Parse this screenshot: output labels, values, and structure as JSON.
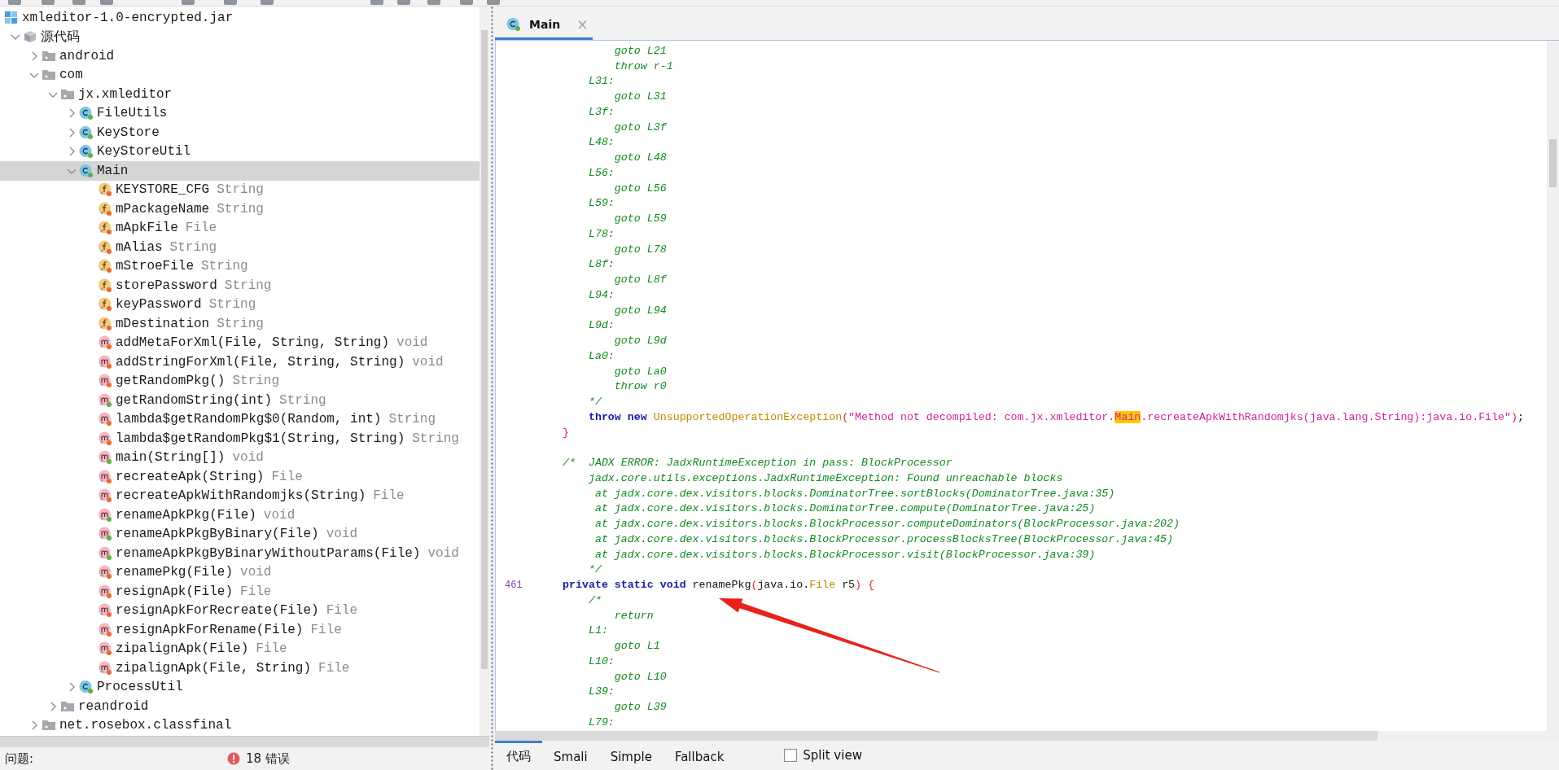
{
  "tree": [
    {
      "kind": "jar",
      "label": "xmleditor-1.0-encrypted.jar",
      "selected": false,
      "children": [
        {
          "kind": "source-root",
          "label": "源代码",
          "expanded": true,
          "selected": false,
          "children": [
            {
              "kind": "folder",
              "label": "android",
              "expanded": false,
              "selected": false
            },
            {
              "kind": "folder",
              "label": "com",
              "expanded": true,
              "selected": false,
              "children": [
                {
                  "kind": "folder",
                  "label": "jx.xmleditor",
                  "expanded": true,
                  "selected": false,
                  "children": [
                    {
                      "kind": "class",
                      "label": "FileUtils",
                      "color": "#5cb145",
                      "expanded": false,
                      "selected": false
                    },
                    {
                      "kind": "class",
                      "label": "KeyStore",
                      "color": "#5cb145",
                      "expanded": false,
                      "selected": false
                    },
                    {
                      "kind": "class",
                      "label": "KeyStoreUtil",
                      "color": "#5cb145",
                      "expanded": false,
                      "selected": false
                    },
                    {
                      "kind": "class",
                      "label": "Main",
                      "color": "#5cb145",
                      "expanded": true,
                      "selected": true,
                      "children": [
                        {
                          "kind": "field",
                          "label": "KEYSTORE_CFG",
                          "type": "String",
                          "color": "#e8692f",
                          "selected": false
                        },
                        {
                          "kind": "field",
                          "label": "mPackageName",
                          "type": "String",
                          "color": "#e8692f",
                          "selected": false
                        },
                        {
                          "kind": "field",
                          "label": "mApkFile",
                          "type": "File",
                          "color": "#e8692f",
                          "selected": false
                        },
                        {
                          "kind": "field",
                          "label": "mAlias",
                          "type": "String",
                          "color": "#e8692f",
                          "selected": false
                        },
                        {
                          "kind": "field",
                          "label": "mStroeFile",
                          "type": "String",
                          "color": "#e8692f",
                          "selected": false
                        },
                        {
                          "kind": "field",
                          "label": "storePassword",
                          "type": "String",
                          "color": "#e8692f",
                          "selected": false
                        },
                        {
                          "kind": "field",
                          "label": "keyPassword",
                          "type": "String",
                          "color": "#e8692f",
                          "selected": false
                        },
                        {
                          "kind": "field",
                          "label": "mDestination",
                          "type": "String",
                          "color": "#e8692f",
                          "selected": false
                        },
                        {
                          "kind": "method",
                          "label": "addMetaForXml(File, String, String)",
                          "type": "void",
                          "color": "#e8692f",
                          "selected": false
                        },
                        {
                          "kind": "method",
                          "label": "addStringForXml(File, String, String)",
                          "type": "void",
                          "color": "#e8692f",
                          "selected": false
                        },
                        {
                          "kind": "method",
                          "label": "getRandomPkg()",
                          "type": "String",
                          "color": "#e8692f",
                          "selected": false
                        },
                        {
                          "kind": "method",
                          "label": "getRandomString(int)",
                          "type": "String",
                          "color": "#5cb145",
                          "selected": false
                        },
                        {
                          "kind": "method",
                          "label": "lambda$getRandomPkg$0(Random, int)",
                          "type": "String",
                          "color": "#e8692f",
                          "selected": false
                        },
                        {
                          "kind": "method",
                          "label": "lambda$getRandomPkg$1(String, String)",
                          "type": "String",
                          "color": "#e8692f",
                          "selected": false
                        },
                        {
                          "kind": "method",
                          "label": "main(String[])",
                          "type": "void",
                          "color": "#5cb145",
                          "selected": false
                        },
                        {
                          "kind": "method",
                          "label": "recreateApk(String)",
                          "type": "File",
                          "color": "#e8692f",
                          "selected": false
                        },
                        {
                          "kind": "method",
                          "label": "recreateApkWithRandomjks(String)",
                          "type": "File",
                          "color": "#e8692f",
                          "selected": false
                        },
                        {
                          "kind": "method",
                          "label": "renameApkPkg(File)",
                          "type": "void",
                          "color": "#5cb145",
                          "selected": false
                        },
                        {
                          "kind": "method",
                          "label": "renameApkPkgByBinary(File)",
                          "type": "void",
                          "color": "#5cb145",
                          "selected": false
                        },
                        {
                          "kind": "method",
                          "label": "renameApkPkgByBinaryWithoutParams(File)",
                          "type": "void",
                          "color": "#5cb145",
                          "selected": false
                        },
                        {
                          "kind": "method",
                          "label": "renamePkg(File)",
                          "type": "void",
                          "color": "#e8692f",
                          "selected": false
                        },
                        {
                          "kind": "method",
                          "label": "resignApk(File)",
                          "type": "File",
                          "color": "#e8692f",
                          "selected": false
                        },
                        {
                          "kind": "method",
                          "label": "resignApkForRecreate(File)",
                          "type": "File",
                          "color": "#e8692f",
                          "selected": false
                        },
                        {
                          "kind": "method",
                          "label": "resignApkForRename(File)",
                          "type": "File",
                          "color": "#e8692f",
                          "selected": false
                        },
                        {
                          "kind": "method",
                          "label": "zipalignApk(File)",
                          "type": "File",
                          "color": "#e8692f",
                          "selected": false
                        },
                        {
                          "kind": "method",
                          "label": "zipalignApk(File, String)",
                          "type": "File",
                          "color": "#e8692f",
                          "selected": false
                        }
                      ]
                    },
                    {
                      "kind": "class",
                      "label": "ProcessUtil",
                      "color": "#5cb145",
                      "expanded": false,
                      "selected": false
                    }
                  ]
                },
                {
                  "kind": "folder",
                  "label": "reandroid",
                  "expanded": false,
                  "selected": false
                }
              ]
            },
            {
              "kind": "folder",
              "label": "net.rosebox.classfinal",
              "expanded": false,
              "selected": false
            }
          ]
        }
      ]
    }
  ],
  "status_bar": {
    "label": "问题:",
    "errors": "18 错误"
  },
  "editor_tabs": [
    {
      "label": "Main",
      "color": "#5cb145",
      "close": "×",
      "selected": true
    }
  ],
  "code_lines": [
    {
      "tokens": [
        {
          "kind": "comment",
          "text": "        goto L21"
        }
      ]
    },
    {
      "tokens": [
        {
          "kind": "comment",
          "text": "        throw r-1"
        }
      ]
    },
    {
      "tokens": [
        {
          "kind": "comment",
          "text": "    L31:"
        }
      ]
    },
    {
      "tokens": [
        {
          "kind": "comment",
          "text": "        goto L31"
        }
      ]
    },
    {
      "tokens": [
        {
          "kind": "comment",
          "text": "    L3f:"
        }
      ]
    },
    {
      "tokens": [
        {
          "kind": "comment",
          "text": "        goto L3f"
        }
      ]
    },
    {
      "tokens": [
        {
          "kind": "comment",
          "text": "    L48:"
        }
      ]
    },
    {
      "tokens": [
        {
          "kind": "comment",
          "text": "        goto L48"
        }
      ]
    },
    {
      "tokens": [
        {
          "kind": "comment",
          "text": "    L56:"
        }
      ]
    },
    {
      "tokens": [
        {
          "kind": "comment",
          "text": "        goto L56"
        }
      ]
    },
    {
      "tokens": [
        {
          "kind": "comment",
          "text": "    L59:"
        }
      ]
    },
    {
      "tokens": [
        {
          "kind": "comment",
          "text": "        goto L59"
        }
      ]
    },
    {
      "tokens": [
        {
          "kind": "comment",
          "text": "    L78:"
        }
      ]
    },
    {
      "tokens": [
        {
          "kind": "comment",
          "text": "        goto L78"
        }
      ]
    },
    {
      "tokens": [
        {
          "kind": "comment",
          "text": "    L8f:"
        }
      ]
    },
    {
      "tokens": [
        {
          "kind": "comment",
          "text": "        goto L8f"
        }
      ]
    },
    {
      "tokens": [
        {
          "kind": "comment",
          "text": "    L94:"
        }
      ]
    },
    {
      "tokens": [
        {
          "kind": "comment",
          "text": "        goto L94"
        }
      ]
    },
    {
      "tokens": [
        {
          "kind": "comment",
          "text": "    L9d:"
        }
      ]
    },
    {
      "tokens": [
        {
          "kind": "comment",
          "text": "        goto L9d"
        }
      ]
    },
    {
      "tokens": [
        {
          "kind": "comment",
          "text": "    La0:"
        }
      ]
    },
    {
      "tokens": [
        {
          "kind": "comment",
          "text": "        goto La0"
        }
      ]
    },
    {
      "tokens": [
        {
          "kind": "comment",
          "text": "        throw r0"
        }
      ]
    },
    {
      "tokens": [
        {
          "kind": "comment",
          "text": "    */"
        }
      ]
    },
    {
      "tokens": [
        {
          "kind": "keyword",
          "text": "    throw new "
        },
        {
          "kind": "type",
          "text": "UnsupportedOperationException"
        },
        {
          "kind": "bracket",
          "text": "("
        },
        {
          "kind": "string",
          "text": "\"Method not decompiled: com.jx.xmleditor."
        },
        {
          "kind": "highlight",
          "text": "Main"
        },
        {
          "kind": "string",
          "text": ".recreateApkWithRandomjks(java.lang.String):java.io.File\""
        },
        {
          "kind": "bracket",
          "text": ")"
        },
        {
          "kind": "plain",
          "text": ";"
        }
      ]
    },
    {
      "tokens": [
        {
          "kind": "bracket",
          "text": "}"
        }
      ]
    },
    {
      "blank_before": true,
      "tokens": [
        {
          "kind": "comment",
          "text": "/*  JADX ERROR: JadxRuntimeException in pass: BlockProcessor"
        }
      ]
    },
    {
      "tokens": [
        {
          "kind": "comment",
          "text": "    jadx.core.utils.exceptions.JadxRuntimeException: Found unreachable blocks"
        }
      ]
    },
    {
      "tokens": [
        {
          "kind": "comment",
          "text": "     at jadx.core.dex.visitors.blocks.DominatorTree.sortBlocks(DominatorTree.java:35)"
        }
      ]
    },
    {
      "tokens": [
        {
          "kind": "comment",
          "text": "     at jadx.core.dex.visitors.blocks.DominatorTree.compute(DominatorTree.java:25)"
        }
      ]
    },
    {
      "tokens": [
        {
          "kind": "comment",
          "text": "     at jadx.core.dex.visitors.blocks.BlockProcessor.computeDominators(BlockProcessor.java:202)"
        }
      ]
    },
    {
      "tokens": [
        {
          "kind": "comment",
          "text": "     at jadx.core.dex.visitors.blocks.BlockProcessor.processBlocksTree(BlockProcessor.java:45)"
        }
      ]
    },
    {
      "tokens": [
        {
          "kind": "comment",
          "text": "     at jadx.core.dex.visitors.blocks.BlockProcessor.visit(BlockProcessor.java:39)"
        }
      ]
    },
    {
      "tokens": [
        {
          "kind": "comment",
          "text": "    */"
        }
      ]
    },
    {
      "number": "461",
      "tokens": [
        {
          "kind": "keyword",
          "text": "private static void"
        },
        {
          "kind": "plain",
          "text": " renamePkg"
        },
        {
          "kind": "bracket",
          "text": "("
        },
        {
          "kind": "plain",
          "text": "java.io."
        },
        {
          "kind": "type",
          "text": "File"
        },
        {
          "kind": "plain",
          "text": " r5"
        },
        {
          "kind": "bracket",
          "text": ") {"
        }
      ]
    },
    {
      "tokens": [
        {
          "kind": "comment",
          "text": "    /*"
        }
      ]
    },
    {
      "tokens": [
        {
          "kind": "comment",
          "text": "        return"
        }
      ]
    },
    {
      "tokens": [
        {
          "kind": "comment",
          "text": "    L1:"
        }
      ]
    },
    {
      "tokens": [
        {
          "kind": "comment",
          "text": "        goto L1"
        }
      ]
    },
    {
      "tokens": [
        {
          "kind": "comment",
          "text": "    L10:"
        }
      ]
    },
    {
      "tokens": [
        {
          "kind": "comment",
          "text": "        goto L10"
        }
      ]
    },
    {
      "tokens": [
        {
          "kind": "comment",
          "text": "    L39:"
        }
      ]
    },
    {
      "tokens": [
        {
          "kind": "comment",
          "text": "        goto L39"
        }
      ]
    },
    {
      "tokens": [
        {
          "kind": "comment",
          "text": "    L79:"
        }
      ]
    }
  ],
  "view_tabs": [
    {
      "label": "代码",
      "selected": true
    },
    {
      "label": "Smali",
      "selected": false
    },
    {
      "label": "Simple",
      "selected": false
    },
    {
      "label": "Fallback",
      "selected": false
    }
  ],
  "split_view": {
    "label": "Split view",
    "checked": false
  }
}
